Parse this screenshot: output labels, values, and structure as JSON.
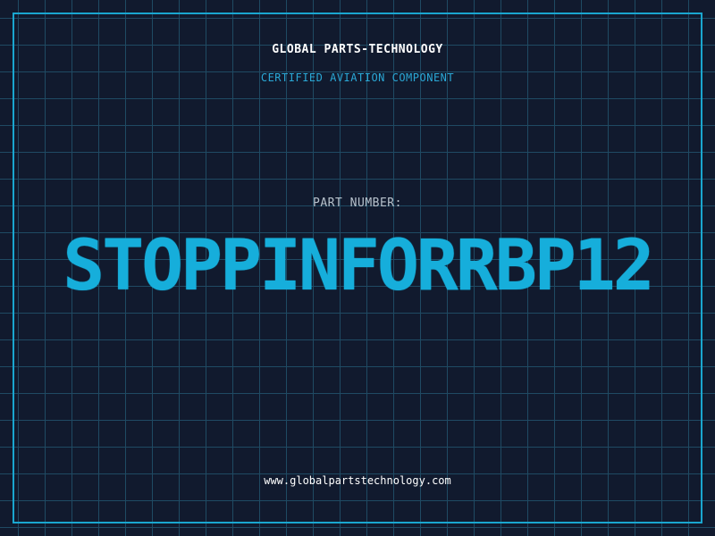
{
  "header": {
    "company": "GLOBAL PARTS-TECHNOLOGY",
    "certification": "CERTIFIED AVIATION COMPONENT"
  },
  "main": {
    "part_label": "PART NUMBER:",
    "part_number": "STOPPINFORRBP12"
  },
  "footer": {
    "website": "www.globalpartstechnology.com"
  },
  "colors": {
    "background": "#111a2e",
    "grid": "#1f4a63",
    "accent": "#16aedb",
    "frame": "#1aa6cf"
  }
}
